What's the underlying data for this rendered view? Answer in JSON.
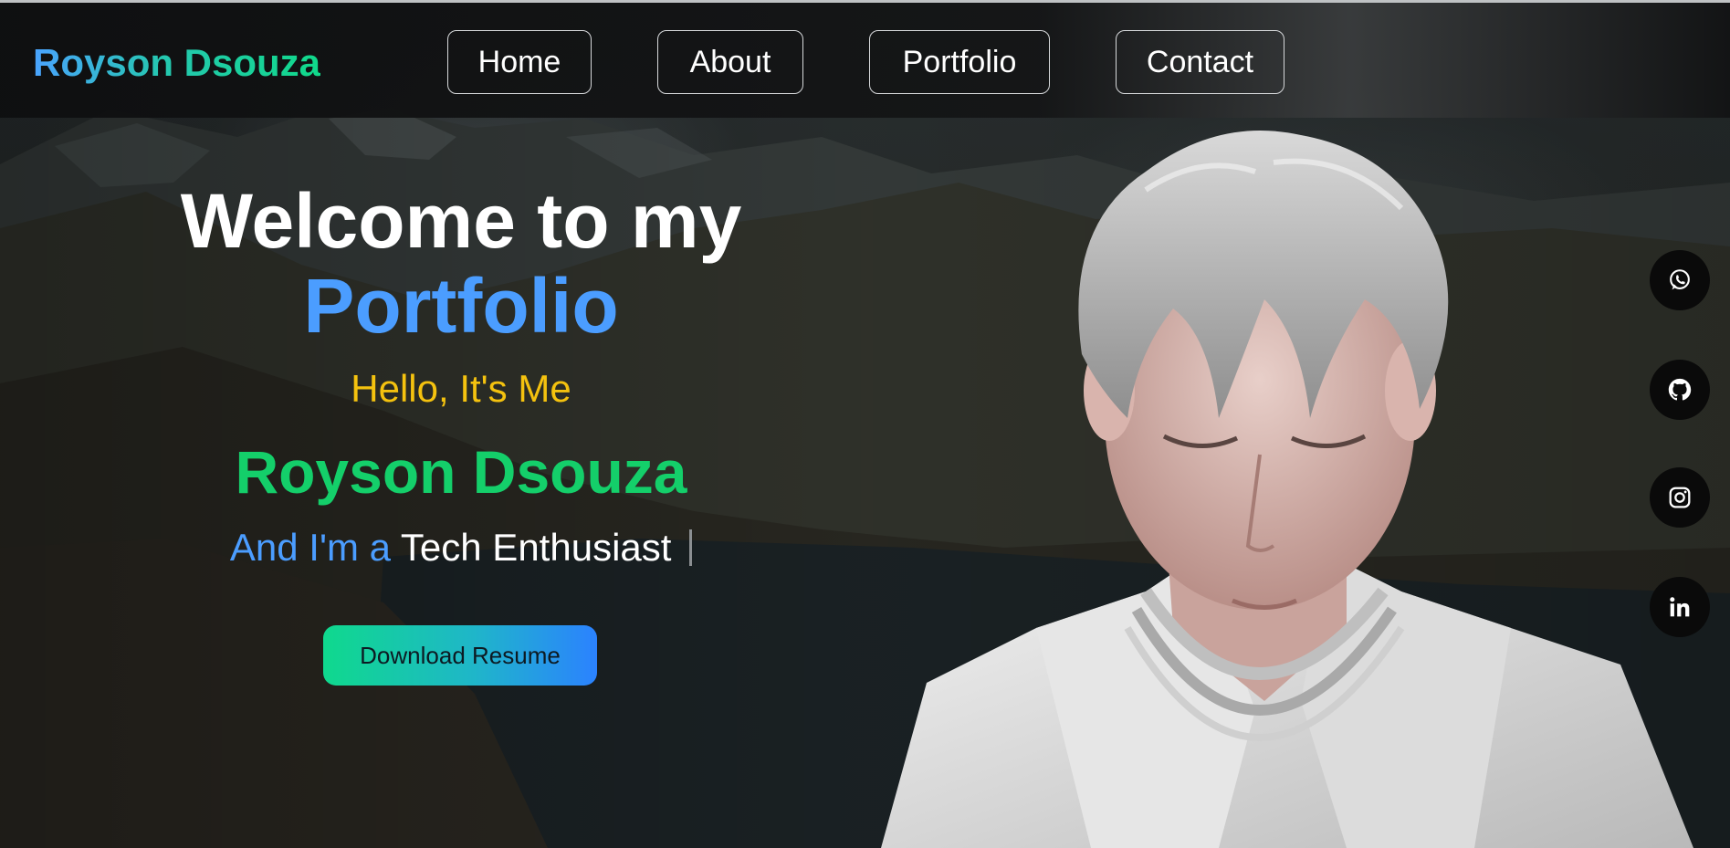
{
  "header": {
    "logo": "Royson Dsouza",
    "nav": [
      {
        "label": "Home"
      },
      {
        "label": "About"
      },
      {
        "label": "Portfolio"
      },
      {
        "label": "Contact"
      }
    ]
  },
  "hero": {
    "heading_line1": "Welcome to my",
    "heading_line2": "Portfolio",
    "greeting": "Hello, It's Me",
    "name": "Royson Dsouza",
    "role_prefix": "And I'm a",
    "role_word": "Tech Enthusiast",
    "cta_label": "Download Resume"
  },
  "social": [
    {
      "icon": "whatsapp-icon"
    },
    {
      "icon": "github-icon"
    },
    {
      "icon": "instagram-icon"
    },
    {
      "icon": "linkedin-icon"
    }
  ],
  "colors": {
    "accent_blue": "#4b9dff",
    "accent_green": "#14cf6a",
    "accent_yellow": "#f4c20f",
    "header_bg": "#0e0f10"
  }
}
